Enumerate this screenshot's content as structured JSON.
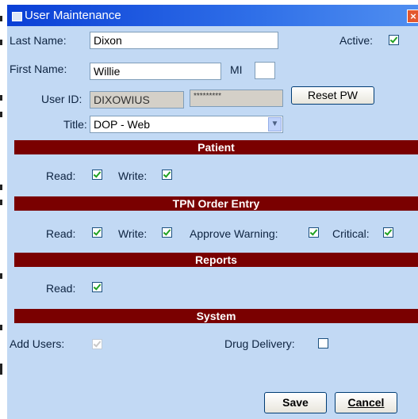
{
  "window": {
    "title": "User Maintenance",
    "close_glyph": "×"
  },
  "form": {
    "last_name_label": "Last Name:",
    "last_name_value": "Dixon",
    "active_label": "Active:",
    "active_checked": true,
    "first_name_label": "First Name:",
    "first_name_value": "Willie",
    "mi_label": "MI",
    "mi_value": "",
    "user_id_label": "User ID:",
    "user_id_value": "DIXOWIUS",
    "password_value": "*********",
    "reset_pw_label": "Reset PW",
    "title_label": "Title:",
    "title_value": "DOP - Web"
  },
  "sections": {
    "patient": {
      "header": "Patient",
      "read_label": "Read:",
      "read_checked": true,
      "write_label": "Write:",
      "write_checked": true
    },
    "tpn": {
      "header": "TPN Order Entry",
      "read_label": "Read:",
      "read_checked": true,
      "write_label": "Write:",
      "write_checked": true,
      "approve_label": "Approve Warning:",
      "approve_checked": true,
      "critical_label": "Critical:",
      "critical_checked": true
    },
    "reports": {
      "header": "Reports",
      "read_label": "Read:",
      "read_checked": true
    },
    "system": {
      "header": "System",
      "add_users_label": "Add Users:",
      "add_users_checked": true,
      "drug_delivery_label": "Drug Delivery:",
      "drug_delivery_checked": false
    }
  },
  "buttons": {
    "save": "Save",
    "cancel": "Cancel"
  },
  "colors": {
    "section_bar": "#7a0000",
    "form_bg": "#c2d9f4",
    "titlebar": "#0a3fd6",
    "check": "#21a121"
  }
}
